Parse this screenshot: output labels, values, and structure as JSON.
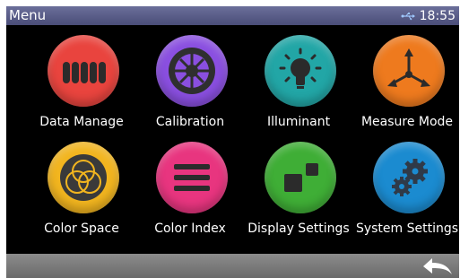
{
  "status_bar": {
    "title": "Menu",
    "time": "18:55",
    "usb_icon": "usb-icon"
  },
  "menu": {
    "items": [
      {
        "label": "Data Manage",
        "color": "#e9443e",
        "icon": "books-icon"
      },
      {
        "label": "Calibration",
        "color": "#8a4fe0",
        "icon": "dial-icon"
      },
      {
        "label": "Illuminant",
        "color": "#22a6a6",
        "icon": "lightbulb-icon"
      },
      {
        "label": "Measure Mode",
        "color": "#ee7a1e",
        "icon": "arrows-icon"
      },
      {
        "label": "Color Space",
        "color": "#f2b51f",
        "icon": "venn-circles-icon"
      },
      {
        "label": "Color Index",
        "color": "#e8357f",
        "icon": "list-lines-icon"
      },
      {
        "label": "Display Settings",
        "color": "#3fae36",
        "icon": "windows-icon"
      },
      {
        "label": "System Settings",
        "color": "#1b8bd0",
        "icon": "gears-icon"
      }
    ]
  },
  "bottom_bar": {
    "back_icon": "back-arrow-icon"
  }
}
